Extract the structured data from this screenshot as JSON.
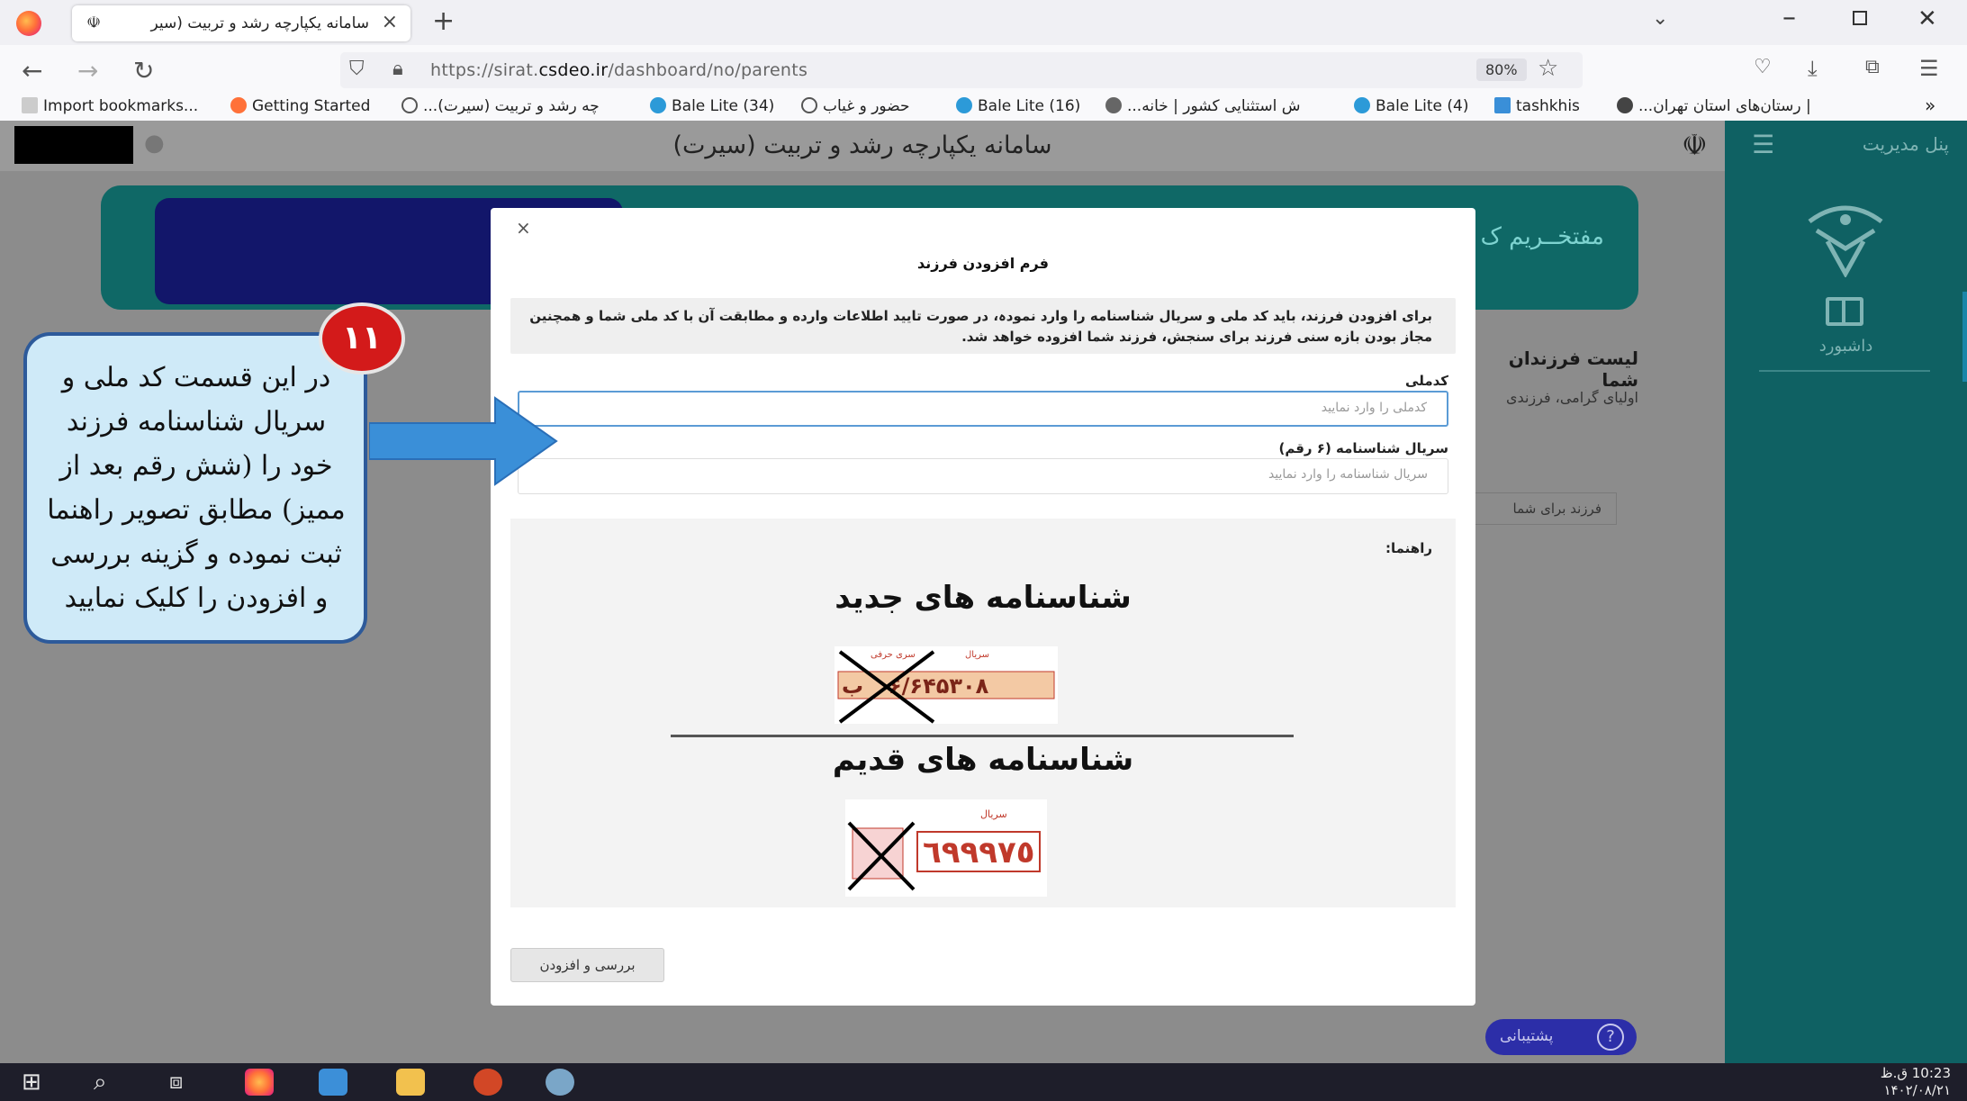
{
  "browser": {
    "tab_title": "سامانه یکپارچه رشد و تربیت (سیر",
    "new_tab": "+",
    "url_prefix": "https://sirat.",
    "url_domain": "csdeo.ir",
    "url_suffix": "/dashboard/no/parents",
    "zoom": "80%",
    "bookmarks": [
      "Import bookmarks...",
      "Getting Started",
      "...چه رشد و تربیت (سیرت)",
      "Bale Lite (34)",
      "حضور و غیاب",
      "Bale Lite (16)",
      "...ش استثنایی کشور | خانه",
      "Bale Lite (4)",
      "tashkhis",
      "...رستان‌های استان تهران |"
    ],
    "overflow": "»"
  },
  "page": {
    "site_title": "سامانه یکپارچه رشد و تربیت (سیرت)",
    "banner_text": "مفتخــریم ک",
    "kids_heading": "لیست فرزندان شما",
    "kids_sub": "اولیای گرامی، فرزندی",
    "kids_button": "فرزند برای شما",
    "sidebar": {
      "panel_title": "پنل مدیریت",
      "dashboard_label": "داشبورد"
    },
    "support_label": "پشتیبانی",
    "help_glyph": "?"
  },
  "modal": {
    "close": "×",
    "title": "فرم افزودن فرزند",
    "info": "برای افزودن فرزند، باید کد ملی و سریال شناسنامه را وارد نمودہ، در صورت تایید اطلاعات وارده و مطابقت آن با کد ملی شما و همچنین مجاز بودن بازه سنی فرزند برای سنجش، فرزند شما افزوده خواهد شد.",
    "national_code_label": "کدملی",
    "national_code_placeholder": "کدملی را وارد نمایید",
    "serial_label": "سریال شناسنامه (۶ رقم)",
    "serial_placeholder": "سریال شناسنامه را وارد نمایید",
    "guide_label": "راهنما:",
    "new_id_heading": "شناسنامه های جدید",
    "new_id_example": "۶/۶۴۵۳۰۸",
    "new_id_letter": "ب",
    "new_id_caption_serial": "سریال",
    "new_id_caption_series": "سری حرفی",
    "old_id_heading": "شناسنامه های قدیم",
    "old_id_example": "٦٩٩٩٧٥",
    "old_id_caption_serial": "سریال",
    "submit": "بررسی و افزودن"
  },
  "annotation": {
    "step": "۱۱",
    "lines": [
      "در این قسمت کد ملی و",
      "سریال شناسنامه فرزند",
      "خود را (شش رقم بعد از",
      "ممیز) مطابق تصویر راهنما",
      "ثبت نموده و گزینه بررسی",
      "و افزودن را کلیک نمایید"
    ],
    "callout_color": "#cfeaf8",
    "arrow_color": "#3a8fd8",
    "badge_color": "#d31a1a"
  },
  "taskbar": {
    "time": "10:23 ق.ظ",
    "date": "۱۴۰۲/۰۸/۲۱"
  }
}
